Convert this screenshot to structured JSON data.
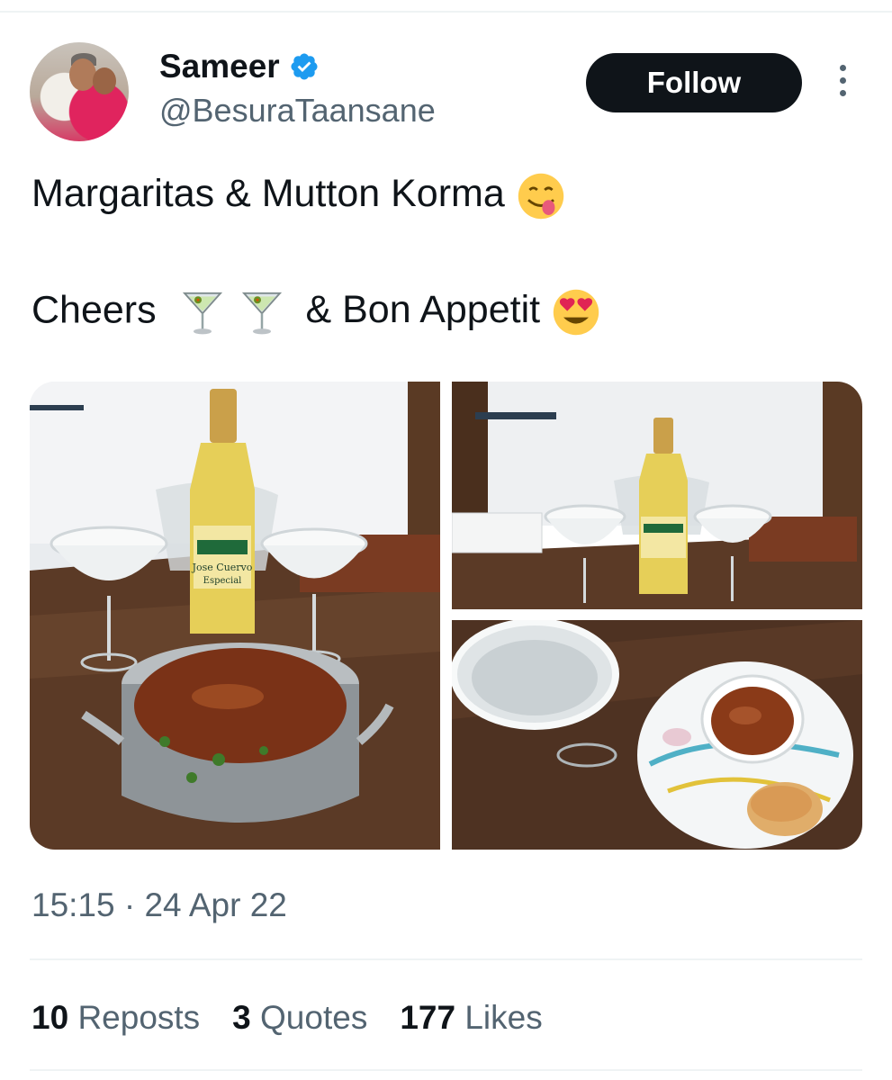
{
  "author": {
    "name": "Sameer",
    "handle": "@BesuraTaansane",
    "verified_color": "#1d9bf0"
  },
  "actions": {
    "follow_label": "Follow"
  },
  "tweet": {
    "line1_text": "Margaritas & Mutton Korma",
    "line1_emoji": "face-savoring-food-emoji",
    "line2_text_a": "Cheers",
    "line2_emoji_a": "cocktail-glass-emoji",
    "line2_text_b": "& Bon Appetit",
    "line2_emoji_b": "smiling-face-with-heart-eyes-emoji",
    "media_count": 3
  },
  "timestamp": "15:15 · 24 Apr 22",
  "stats": {
    "reposts_count": "10",
    "reposts_label": "Reposts",
    "quotes_count": "3",
    "quotes_label": "Quotes",
    "likes_count": "177",
    "likes_label": "Likes"
  },
  "colors": {
    "text_primary": "#0f1419",
    "text_secondary": "#536471",
    "follow_bg": "#0f1419",
    "divider": "#eff3f4"
  }
}
